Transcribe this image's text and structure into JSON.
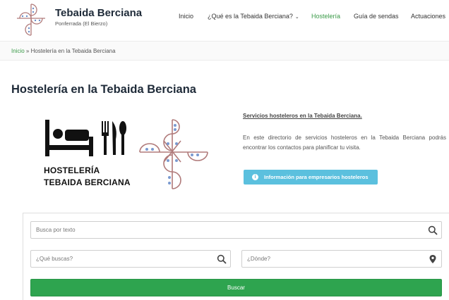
{
  "header": {
    "site_title": "Tebaida Berciana",
    "tagline": "Ponferrada (El Bierzo)",
    "nav": [
      {
        "label": "Inicio"
      },
      {
        "label": "¿Qué es la Tebaida Berciana?"
      },
      {
        "label": "Hostelería"
      },
      {
        "label": "Guía de sendas"
      },
      {
        "label": "Actuaciones"
      }
    ],
    "active_color": "#3a9a48"
  },
  "breadcrumb": {
    "home": "Inicio",
    "separator": "»",
    "current": "Hostelería en la Tebaida Berciana"
  },
  "page": {
    "title": "Hostelería en la Tebaida Berciana",
    "hero_line1": "HOSTELERÍA",
    "hero_line2": "TEBAIDA BERCIANA",
    "side_title": "Servicios hosteleros en la Tebaida Berciana.",
    "side_desc": "En este directorio de servicios hosteleros en la Tebaida Berciana podrás encontrar los contactos para planificar tu visita.",
    "info_button": "Información para empresarios hosteleros",
    "info_color": "#5bc0de"
  },
  "search": {
    "text_placeholder": "Busca por texto",
    "what_placeholder": "¿Qué buscas?",
    "where_placeholder": "¿Dónde?",
    "button_label": "Buscar",
    "button_color": "#2ea44f"
  },
  "icons": [
    "logo-mark",
    "bed-icon",
    "fork-icon",
    "knife-icon",
    "spoon-icon",
    "info-icon",
    "search-icon",
    "map-pin-icon"
  ]
}
